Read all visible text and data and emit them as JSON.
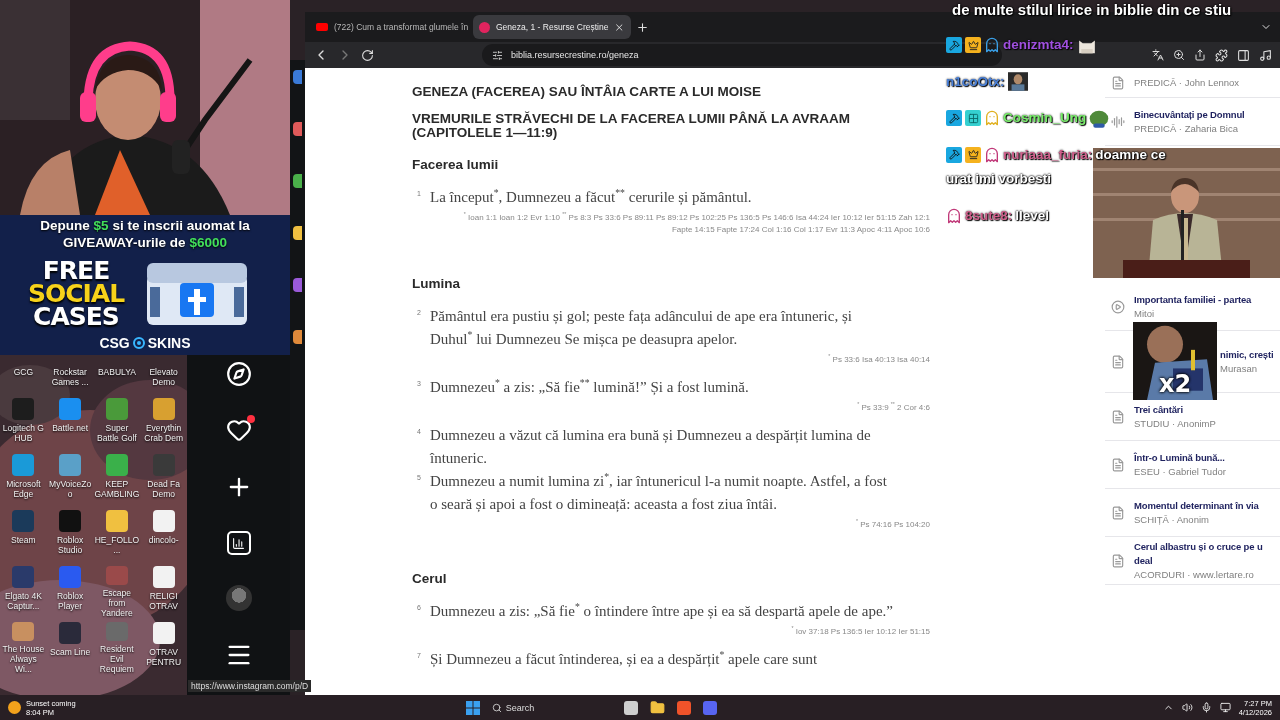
{
  "promo": {
    "headline": {
      "before": "Depune",
      "highlight": "$5",
      "after": "si te inscrii auomat la"
    },
    "subline": {
      "before": "GIVEAWAY-urile de",
      "highlight": "$6000"
    },
    "title_lines": [
      "FREE",
      "SOCIAL",
      "CASES"
    ],
    "brand_left": "CSG",
    "brand_right": "SKINS"
  },
  "desktop_icons": [
    {
      "label": "GCG"
    },
    {
      "label": "Rockstar Games ..."
    },
    {
      "label": "BABULYA"
    },
    {
      "label": "Elevato Demo"
    },
    {
      "label": "Logitech G HUB",
      "color": "#1d1d1d"
    },
    {
      "label": "Battle.net",
      "color": "#1a8ff0"
    },
    {
      "label": "Super Battle Golf",
      "color": "#4a9a3a"
    },
    {
      "label": "Everythin Crab Dem",
      "color": "#d8a030"
    },
    {
      "label": "Microsoft Edge",
      "color": "#1a9ad8"
    },
    {
      "label": "MyVoiceZoo",
      "color": "#5aa0c8"
    },
    {
      "label": "KEEP GAMBLING",
      "color": "#3ab04a"
    },
    {
      "label": "Dead Fa Demo",
      "color": "#3a3a3a"
    },
    {
      "label": "Steam",
      "color": "#1b3a5a"
    },
    {
      "label": "Roblox Studio",
      "color": "#111111"
    },
    {
      "label": "HE_FOLLO...",
      "color": "#f0c040"
    },
    {
      "label": "dincolo-",
      "color": "#f2f2f2"
    },
    {
      "label": "Elgato 4K Captur...",
      "color": "#2a3a6a"
    },
    {
      "label": "Roblox Player",
      "color": "#2a5af0"
    },
    {
      "label": "Escape from Yandere",
      "color": "#9a4a4a"
    },
    {
      "label": "RELIGI OTRAV",
      "color": "#f2f2f2"
    },
    {
      "label": "The House Always Wi...",
      "color": "#c89060"
    },
    {
      "label": "Scam Line",
      "color": "#2a2a3a"
    },
    {
      "label": "Resident Evil Requiem",
      "color": "#6a6a6a"
    },
    {
      "label": "OTRAV PENTRU",
      "color": "#f2f2f2"
    }
  ],
  "instagram_sidebar": {
    "items": [
      {
        "kind": "compass"
      },
      {
        "kind": "heart",
        "notification": true
      },
      {
        "kind": "plus"
      },
      {
        "kind": "chart"
      },
      {
        "kind": "avatar"
      },
      {
        "kind": "menu"
      }
    ],
    "link_preview": "https://www.instagram.com/p/D"
  },
  "browser": {
    "tabs": [
      {
        "title": "(722) Cum a transformat glumele în",
        "kind": "video",
        "selected": false
      },
      {
        "title": "Geneza, 1 - Resurse Creștine",
        "kind": "site",
        "selected": true
      }
    ],
    "url": "biblia.resursecrestine.ro/geneza"
  },
  "article": {
    "titles": [
      "GENEZA (FACEREA) SAU ÎNTÂIA CARTE A LUI MOISE",
      "VREMURILE STRĂVECHI DE LA FACEREA LUMII PÂNĂ LA AVRAAM (CAPITOLELE 1—11:9)"
    ],
    "sections": [
      {
        "heading": "Facerea lumii",
        "verses": [
          {
            "number": "1",
            "text": [
              "La început",
              {
                "sup": "*"
              },
              ", Dumnezeu a făcut",
              {
                "sup": "**"
              },
              " cerurile și pământul."
            ],
            "refs": [
              {
                "sup": "*"
              },
              " Ioan 1:1 Ioan 1:2 Evr 1:10 ",
              {
                "sup": "**"
              },
              " Ps 8:3 Ps 33:6 Ps 89:11 Ps 89:12 Ps 102:25 Ps 136:5 Ps 146:6 Isa 44:24 Ier 10:12 Ier 51:15 Zah 12:1 Fapte 14:15 Fapte 17:24 Col 1:16 Col 1:17 Evr 11:3 Apoc 4:11 Apoc 10:6"
            ]
          }
        ]
      },
      {
        "heading": "Lumina",
        "verses": [
          {
            "number": "2",
            "text": [
              "Pământul era pustiu și gol; peste fața adâncului de ape era întuneric, și Duhul",
              {
                "sup": "*"
              },
              " lui Dumnezeu Se mișca pe deasupra apelor."
            ],
            "refs": [
              {
                "sup": "*"
              },
              " Ps 33:6 Isa 40:13 Isa 40:14"
            ]
          },
          {
            "number": "3",
            "text": [
              "Dumnezeu",
              {
                "sup": "*"
              },
              " a zis: „Să fie",
              {
                "sup": "**"
              },
              " lumină!” Și a fost lumină."
            ],
            "refs": [
              {
                "sup": "*"
              },
              " Ps 33:9 ",
              {
                "sup": "**"
              },
              " 2 Cor 4:6"
            ]
          },
          {
            "number": "4",
            "text": [
              "Dumnezeu a văzut că lumina era bună și Dumnezeu a despărțit lumina de întuneric."
            ]
          },
          {
            "number": "5",
            "text": [
              "Dumnezeu a numit lumina zi",
              {
                "sup": "*"
              },
              ", iar întunericul l-a numit noapte. Astfel, a fost o seară și apoi a fost o dimineață: aceasta a fost ziua întâi."
            ],
            "refs": [
              {
                "sup": "*"
              },
              " Ps 74:16 Ps 104:20"
            ]
          }
        ]
      },
      {
        "heading": "Cerul",
        "verses": [
          {
            "number": "6",
            "text": [
              "Dumnezeu a zis: „Să fie",
              {
                "sup": "*"
              },
              " o întindere între ape și ea să despartă apele de ape.”"
            ],
            "refs": [
              {
                "sup": "*"
              },
              " Iov 37:18 Ps 136:5 Ier 10:12 Ier 51:15"
            ]
          },
          {
            "number": "7",
            "text": [
              "Și Dumnezeu a făcut întinderea, și ea a despărțit",
              {
                "sup": "*"
              },
              " apele care sunt"
            ]
          }
        ]
      }
    ]
  },
  "related": [
    {
      "kind": "document",
      "subtitle": "PREDICĂ · John Lennox",
      "covered": false
    },
    {
      "kind": "audio",
      "title_lines": [
        "Binecuvântați pe Domnul"
      ],
      "subtitle": "PREDICĂ · Zaharia Bica",
      "covered": false
    },
    {
      "kind": "video",
      "title_lines": [
        "Importanta familiei - partea"
      ],
      "subtitle": "Mitoi",
      "covered": false
    },
    {
      "kind": "document",
      "title_lines": [
        "nimic, crești"
      ],
      "subtitle": "Murasan",
      "covered": true
    },
    {
      "kind": "document",
      "title_lines": [
        "Trei cântări"
      ],
      "subtitle": "STUDIU · AnonimP",
      "covered": false
    },
    {
      "kind": "document",
      "title_lines": [
        "Într-o Lumină bună..."
      ],
      "subtitle": "ESEU · Gabriel Tudor",
      "covered": false
    },
    {
      "kind": "document",
      "title_lines": [
        "Momentul determinant în via"
      ],
      "subtitle": "SCHIȚĂ · Anonim",
      "covered": false
    },
    {
      "kind": "document",
      "title_lines": [
        "Cerul albastru și o cruce pe u",
        "deal"
      ],
      "subtitle": "ACORDURI · www.lertare.ro",
      "covered": false
    }
  ],
  "chat": {
    "messages": [
      {
        "kind": "continuation",
        "text": "de multe stilul lirice in biblie din ce stiu"
      },
      {
        "kind": "message",
        "badges": [
          {
            "kind": "hammer"
          },
          {
            "kind": "crown"
          },
          {
            "kind": "ghost_blue"
          }
        ],
        "user": "denizmta4:",
        "color": "#a050e0",
        "emote": {
          "kind": "cat"
        }
      },
      {
        "kind": "message",
        "user": "n1coOtx:",
        "color": "#4a80d8"
      },
      {
        "kind": "message",
        "badges": [
          {
            "kind": "hammer"
          },
          {
            "kind": "grid"
          },
          {
            "kind": "ghost_yellow"
          }
        ],
        "user": "Cosmin_Ung",
        "color": "#78ee6a",
        "emote": {
          "kind": "blob"
        }
      },
      {
        "kind": "message",
        "badges": [
          {
            "kind": "hammer"
          },
          {
            "kind": "crown"
          },
          {
            "kind": "ghost_pink"
          }
        ],
        "user": "nuriaaa_furia:",
        "color": "#d0608c",
        "text_lines": [
          "doamne ce",
          "urat imi vorbesti"
        ]
      },
      {
        "kind": "message",
        "badges": [
          {
            "kind": "ghost_pink"
          }
        ],
        "user": "8sute8:",
        "color": "#d0608c",
        "text_lines": [
          "llevel"
        ]
      }
    ],
    "combo": "x2"
  },
  "taskbar": {
    "weather_title": "Sunset coming",
    "weather_time": "8:04 PM",
    "search": "Search",
    "time": "7:27 PM",
    "date": "4/12/2026"
  }
}
